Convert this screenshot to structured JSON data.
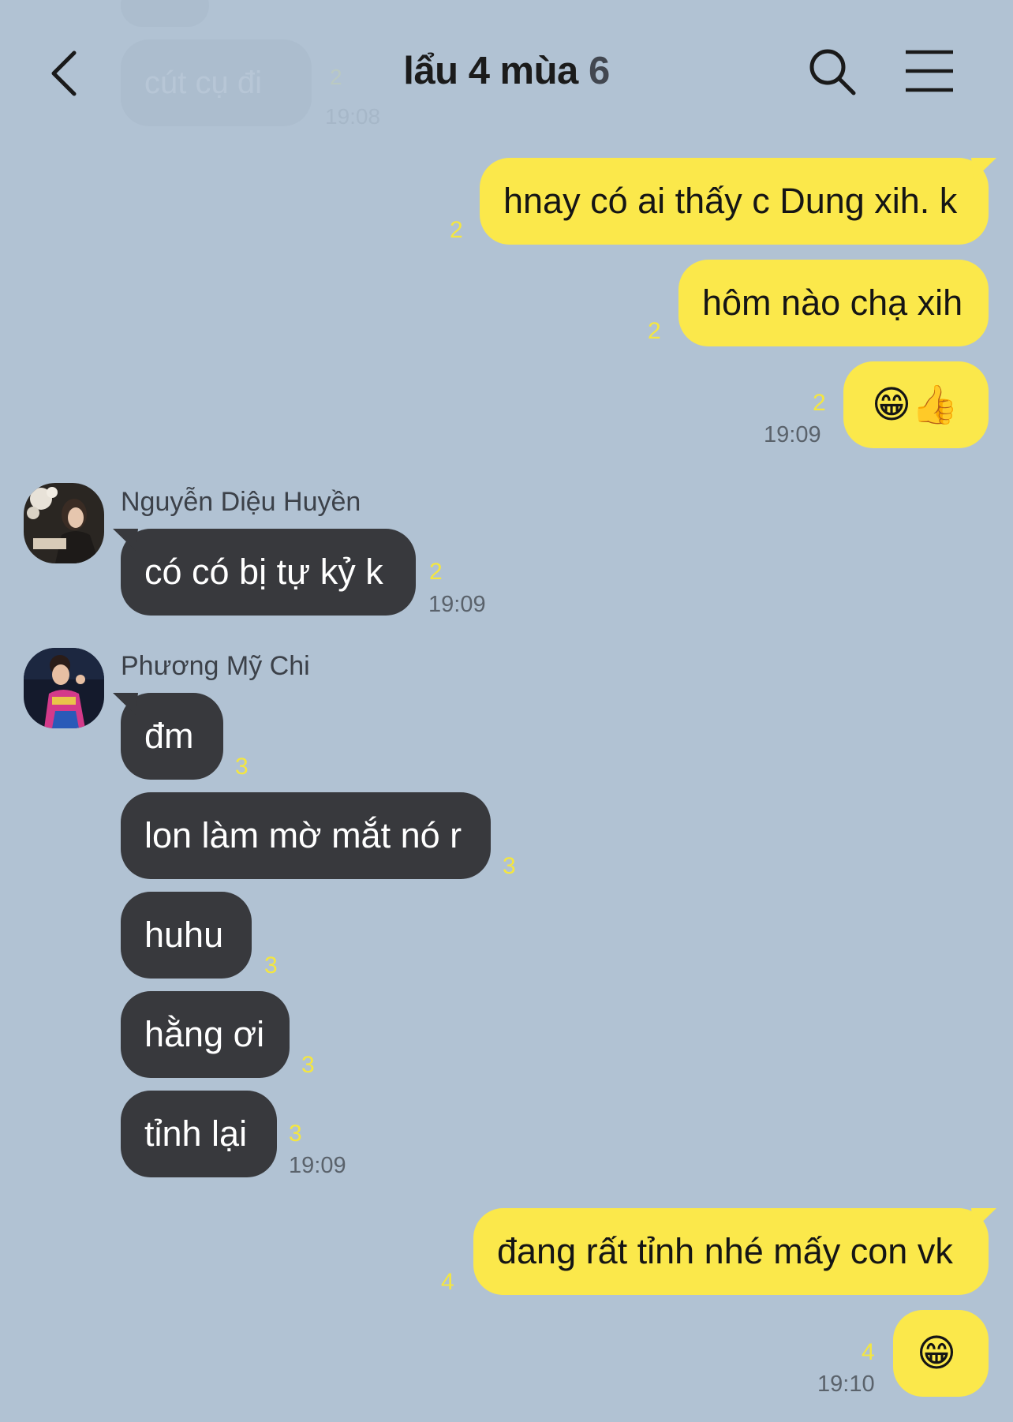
{
  "header": {
    "title": "lẩu 4 mùa",
    "member_count": "6"
  },
  "faded": {
    "text": "cút cụ đi",
    "time": "19:08",
    "count": "2"
  },
  "messages": {
    "m1": {
      "text": "hnay có ai thấy c Dung xih. k",
      "count": "2"
    },
    "m2": {
      "text": "hôm nào chạ xih",
      "count": "2"
    },
    "m3": {
      "text": "😁👍",
      "count": "2",
      "time": "19:09"
    },
    "m4": {
      "sender": "Nguyễn Diệu Huyền",
      "text": "có có bị tự kỷ k",
      "count": "2",
      "time": "19:09"
    },
    "m5": {
      "sender": "Phương Mỹ Chi",
      "text": "đm",
      "count": "3"
    },
    "m6": {
      "text": "lon làm mờ mắt nó r",
      "count": "3"
    },
    "m7": {
      "text": "huhu",
      "count": "3"
    },
    "m8": {
      "text": "hằng ơi",
      "count": "3"
    },
    "m9": {
      "text": "tỉnh lại",
      "count": "3",
      "time": "19:09"
    },
    "m10": {
      "text": "đang rất tỉnh nhé mấy con vk",
      "count": "4"
    },
    "m11": {
      "text": "😁",
      "count": "4",
      "time": "19:10"
    }
  },
  "icons": {
    "back": "chevron-left-icon",
    "search": "search-icon",
    "menu": "hamburger-menu-icon"
  },
  "colors": {
    "background": "#b1c2d3",
    "my_bubble": "#fbe84b",
    "their_bubble": "#38393d",
    "read_count": "#f4e640"
  }
}
